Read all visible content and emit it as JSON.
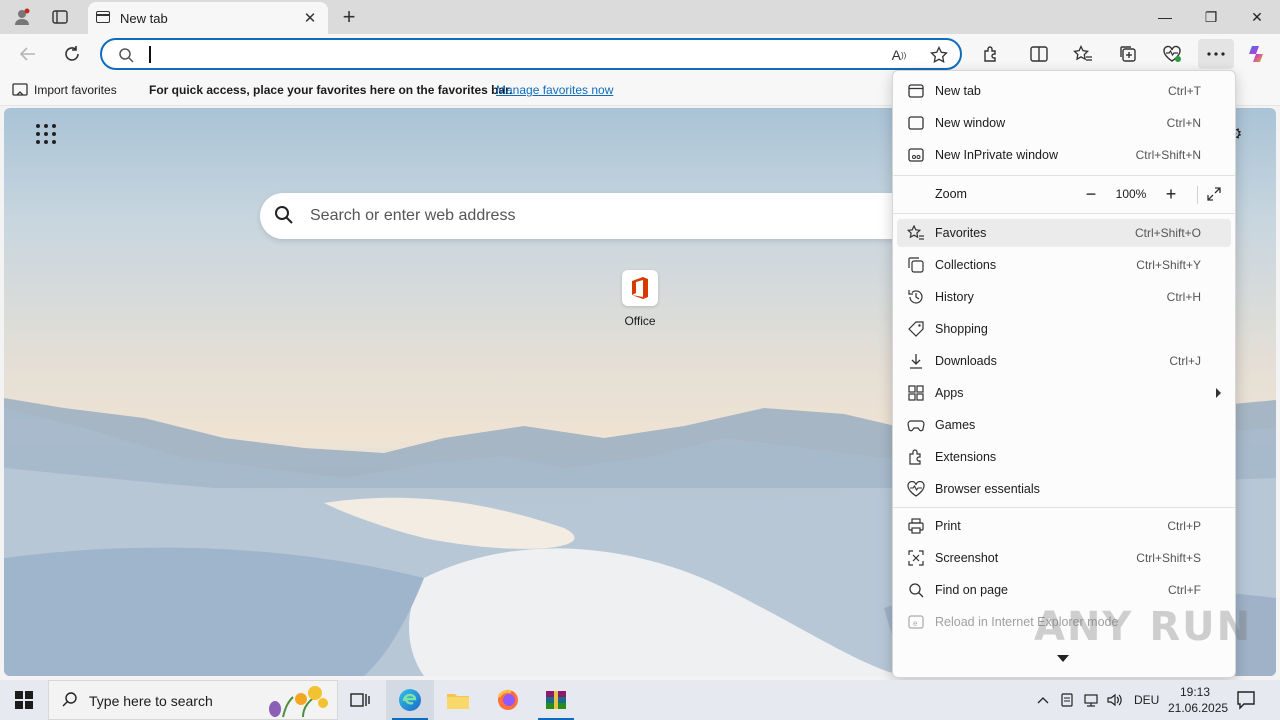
{
  "browser": {
    "tab_title": "New tab",
    "window_controls": {
      "minimize": "—",
      "maximize": "❐",
      "close": "✕"
    }
  },
  "favorites_bar": {
    "import_label": "Import favorites",
    "message": "For quick access, place your favorites here on the favorites bar.",
    "manage_link": "Manage favorites now"
  },
  "new_tab_page": {
    "search_placeholder": "Search or enter web address",
    "tiles": [
      {
        "label": "Office",
        "icon": "office-icon"
      }
    ]
  },
  "menu": {
    "items_top": [
      {
        "label": "New tab",
        "shortcut": "Ctrl+T",
        "icon": "new-tab-icon"
      },
      {
        "label": "New window",
        "shortcut": "Ctrl+N",
        "icon": "new-window-icon"
      },
      {
        "label": "New InPrivate window",
        "shortcut": "Ctrl+Shift+N",
        "icon": "inprivate-icon"
      }
    ],
    "zoom": {
      "label": "Zoom",
      "value": "100%",
      "minus": "−",
      "plus": "+"
    },
    "items_mid": [
      {
        "label": "Favorites",
        "shortcut": "Ctrl+Shift+O",
        "icon": "favorites-icon",
        "hover": true
      },
      {
        "label": "Collections",
        "shortcut": "Ctrl+Shift+Y",
        "icon": "collections-icon"
      },
      {
        "label": "History",
        "shortcut": "Ctrl+H",
        "icon": "history-icon"
      },
      {
        "label": "Shopping",
        "shortcut": "",
        "icon": "shopping-tag-icon"
      },
      {
        "label": "Downloads",
        "shortcut": "Ctrl+J",
        "icon": "download-icon"
      },
      {
        "label": "Apps",
        "shortcut": "",
        "icon": "apps-icon",
        "submenu": true
      },
      {
        "label": "Games",
        "shortcut": "",
        "icon": "games-icon"
      },
      {
        "label": "Extensions",
        "shortcut": "",
        "icon": "extensions-icon"
      },
      {
        "label": "Browser essentials",
        "shortcut": "",
        "icon": "heartbeat-icon"
      }
    ],
    "items_bottom": [
      {
        "label": "Print",
        "shortcut": "Ctrl+P",
        "icon": "print-icon"
      },
      {
        "label": "Screenshot",
        "shortcut": "Ctrl+Shift+S",
        "icon": "screenshot-icon"
      },
      {
        "label": "Find on page",
        "shortcut": "Ctrl+F",
        "icon": "find-icon"
      },
      {
        "label": "Reload in Internet Explorer mode",
        "shortcut": "",
        "icon": "ie-mode-icon",
        "disabled": true
      }
    ]
  },
  "watermark": "ANY RUN",
  "taskbar": {
    "search_placeholder": "Type here to search",
    "language": "DEU",
    "time": "19:13",
    "date": "21.06.2025"
  },
  "colors": {
    "accent": "#0f6cbd",
    "menu_hover": "#ebebeb"
  }
}
